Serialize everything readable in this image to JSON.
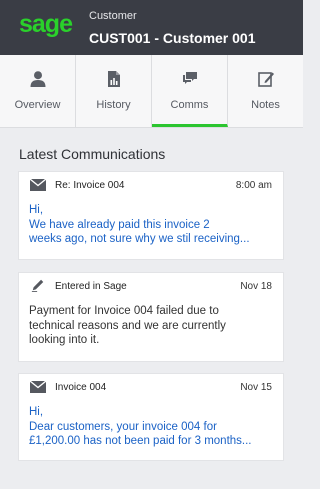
{
  "header": {
    "logo": "sage",
    "crumb": "Customer",
    "title": "CUST001 - Customer 001"
  },
  "tabs": [
    {
      "label": "Overview",
      "icon": "person-icon",
      "active": false
    },
    {
      "label": "History",
      "icon": "document-chart-icon",
      "active": false
    },
    {
      "label": "Comms",
      "icon": "chat-icon",
      "active": true
    },
    {
      "label": "Notes",
      "icon": "edit-note-icon",
      "active": false
    }
  ],
  "section_title": "Latest Communications",
  "cards": [
    {
      "icon": "envelope-icon",
      "subject": "Re: Invoice 004",
      "date": "8:00 am",
      "line1": "Hi,",
      "line2": "We have already paid this invoice 2",
      "line3": "weeks ago, not sure why we stil receiving..."
    },
    {
      "icon": "pencil-icon",
      "subject": "Entered in Sage",
      "date": "Nov 18",
      "line1": "Payment for Invoice 004 failed due to",
      "line2": "technical reasons and we are currently",
      "line3": "looking into it."
    },
    {
      "icon": "envelope-icon",
      "subject": "Invoice 004",
      "date": "Nov 15",
      "line1": "Hi,",
      "line2": "Dear customers, your invoice 004 for",
      "line3": "£1,200.00 has not been paid for 3 months..."
    }
  ],
  "colors": {
    "header_bg": "#3a3d45",
    "brand_green": "#2ad12b",
    "active_tab": "#2bc52f",
    "link_blue": "#1b62c6"
  }
}
